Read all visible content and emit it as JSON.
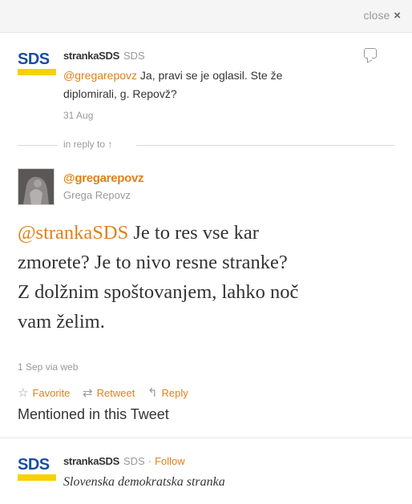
{
  "topbar": {
    "close_label": "close",
    "close_icon": "×"
  },
  "tweet1": {
    "logo_text": "SDS",
    "name": "strankaSDS",
    "handle": "SDS",
    "mention": "@gregarepovz",
    "text_line1": " Ja, pravi se je oglasil. Ste že",
    "text_line2": "diplomirali, g. Repovž?",
    "date": "31 Aug"
  },
  "in_reply": {
    "label": "in reply to ↑"
  },
  "tweet2": {
    "handle": "@gregarepovz",
    "name": "Grega Repovz",
    "mention": "@strankaSDS",
    "text_line1": " Je to res vse kar",
    "text_line2": "zmorete? Je to nivo resne stranke?",
    "text_line3": "Z dolžnim spoštovanjem, lahko noč",
    "text_line4": "vam želim.",
    "meta": "1 Sep via web",
    "actions": {
      "favorite": "Favorite",
      "retweet": "Retweet",
      "reply": "Reply"
    },
    "mentioned_label": "Mentioned in this Tweet"
  },
  "mentioned_user": {
    "logo_text": "SDS",
    "name": "strankaSDS",
    "handle": "SDS",
    "separator": "·",
    "follow": "Follow",
    "bio": "Slovenska demokratska stranka"
  },
  "colors": {
    "accent": "#e0801a",
    "sds_blue": "#1a4ea0",
    "sds_yellow": "#f6d100",
    "muted": "#999999"
  }
}
